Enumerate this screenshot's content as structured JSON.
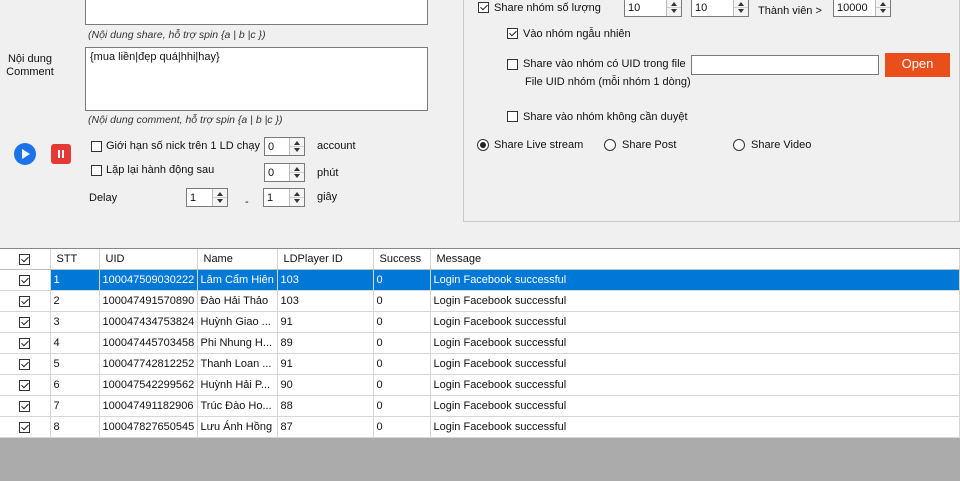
{
  "left_panel": {
    "share_hint": "(Nội dung share, hỗ trợ spin {a | b |c })",
    "comment_label": "Nội dung Comment",
    "comment_value": "{mua liền|đẹp quá|hhi|hay}",
    "comment_hint": "(Nội dung comment, hỗ trợ spin {a | b |c })",
    "limit_label": "Giới hạn số nick trên 1 LD chạy",
    "limit_value": "0",
    "limit_unit": "account",
    "repeat_label": "Lặp lại hành động sau",
    "repeat_value": "0",
    "repeat_unit": "phút",
    "delay_label": "Delay",
    "delay_from": "1",
    "delay_sep": "-",
    "delay_to": "1",
    "delay_unit": "giây"
  },
  "right_panel": {
    "share_groups_label": "Share nhóm số lượng",
    "share_groups_checked": true,
    "group_min": "10",
    "group_max": "10",
    "members_label": "Thành viên >",
    "members_value": "10000",
    "random_groups_label": "Vào nhóm ngẫu nhiên",
    "random_groups_checked": true,
    "uid_groups_label_line1": "Share vào nhóm có UID trong file",
    "uid_groups_label_line2": "File UID nhóm (mỗi nhóm 1 dòng)",
    "uid_groups_checked": false,
    "uid_file_value": "",
    "open_button": "Open",
    "no_approval_label": "Share vào nhóm không cần duyệt",
    "no_approval_checked": false,
    "radio_livestream": "Share Live stream",
    "radio_post": "Share Post",
    "radio_video": "Share Video",
    "selected_radio": "livestream"
  },
  "grid": {
    "columns": [
      "STT",
      "UID",
      "Name",
      "LDPlayer ID",
      "Success",
      "Message"
    ],
    "rows": [
      {
        "stt": "1",
        "uid": "100047509030222",
        "name": "Lâm Cẩm Hiên",
        "ld": "103",
        "success": "0",
        "message": "Login Facebook successful"
      },
      {
        "stt": "2",
        "uid": "100047491570890",
        "name": "Đào Hải Thảo",
        "ld": "103",
        "success": "0",
        "message": "Login Facebook successful"
      },
      {
        "stt": "3",
        "uid": "100047434753824",
        "name": "Huỳnh Giao ...",
        "ld": "91",
        "success": "0",
        "message": "Login Facebook successful"
      },
      {
        "stt": "4",
        "uid": "100047445703458",
        "name": "Phi Nhung H...",
        "ld": "89",
        "success": "0",
        "message": "Login Facebook successful"
      },
      {
        "stt": "5",
        "uid": "100047742812252",
        "name": "Thanh Loan ...",
        "ld": "91",
        "success": "0",
        "message": "Login Facebook successful"
      },
      {
        "stt": "6",
        "uid": "100047542299562",
        "name": "Huỳnh Hải P...",
        "ld": "90",
        "success": "0",
        "message": "Login Facebook successful"
      },
      {
        "stt": "7",
        "uid": "100047491182906",
        "name": "Trúc Đào Ho...",
        "ld": "88",
        "success": "0",
        "message": "Login Facebook successful"
      },
      {
        "stt": "8",
        "uid": "100047827650545",
        "name": "Lưu Ánh Hồng",
        "ld": "87",
        "success": "0",
        "message": "Login Facebook successful"
      }
    ],
    "selected_row": 1
  },
  "colors": {
    "accent_open": "#ea4e1b",
    "play": "#1a73e8",
    "stop": "#e53935",
    "row_selected": "#0078d7"
  }
}
